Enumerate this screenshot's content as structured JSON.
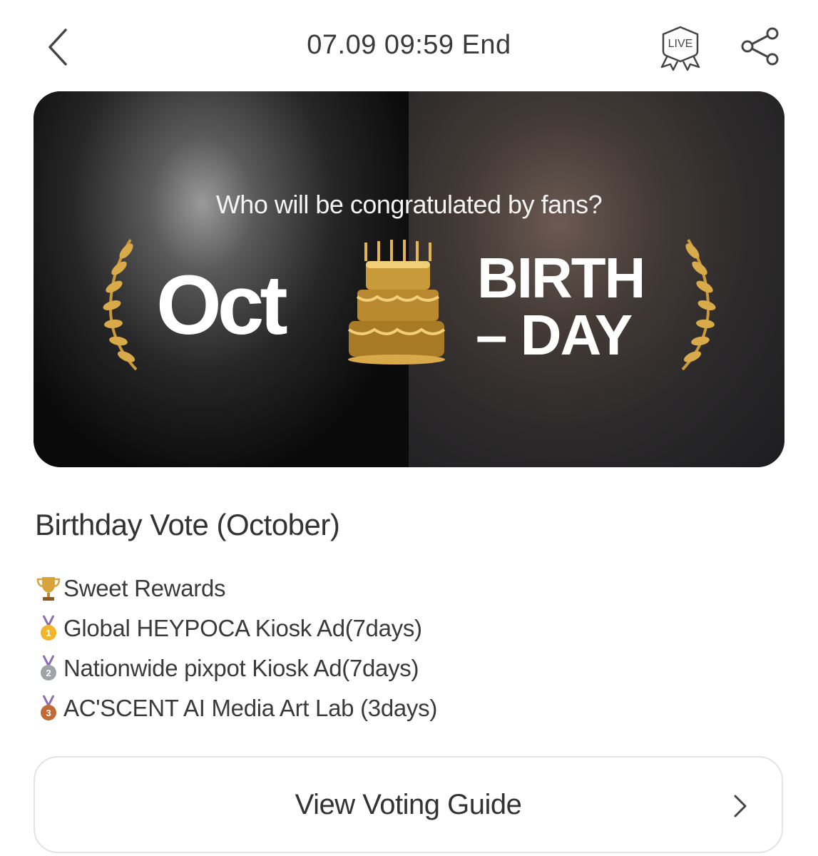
{
  "header": {
    "end_time": "07.09 09:59 End",
    "live_label": "LIVE"
  },
  "banner": {
    "tagline": "Who will be congratulated by fans?",
    "month": "Oct",
    "word1": "BIRTH",
    "word2": "– DAY",
    "colors": {
      "gold": "#c99a3a",
      "text": "#ffffff"
    }
  },
  "vote": {
    "title": "Birthday Vote (October)",
    "rewards": [
      {
        "icon": "trophy-icon",
        "text": "Sweet Rewards"
      },
      {
        "icon": "gold-medal-icon",
        "text": "Global HEYPOCA Kiosk Ad(7days)"
      },
      {
        "icon": "silver-medal-icon",
        "text": "Nationwide pixpot Kiosk Ad(7days)"
      },
      {
        "icon": "bronze-medal-icon",
        "text": "AC'SCENT AI Media Art Lab (3days)"
      }
    ]
  },
  "guide": {
    "label": "View Voting Guide"
  }
}
